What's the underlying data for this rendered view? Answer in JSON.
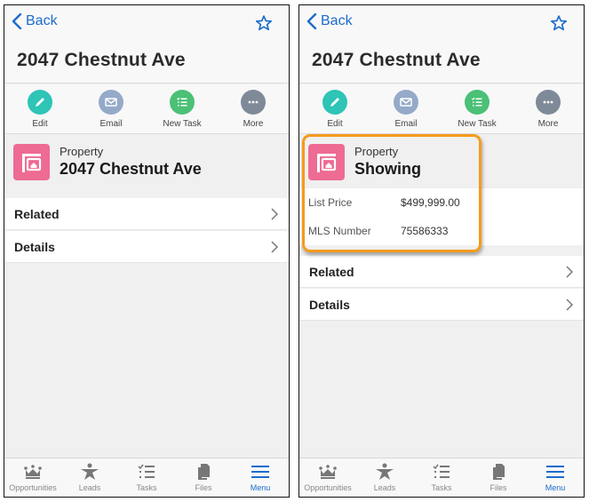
{
  "colors": {
    "accent": "#1c6ccb",
    "edit": "#2ec4b6",
    "email": "#95aac9",
    "new_task": "#4bc076",
    "more": "#7f8a99",
    "object_icon": "#ee6b93",
    "highlight": "#f59b1b"
  },
  "screens": [
    {
      "nav": {
        "back_label": "Back",
        "back_icon": "chevron-left-icon",
        "favorite_icon": "star-outline-icon"
      },
      "title": "2047 Chestnut Ave",
      "actions": [
        {
          "label": "Edit",
          "icon": "pencil-icon"
        },
        {
          "label": "Email",
          "icon": "envelope-icon"
        },
        {
          "label": "New Task",
          "icon": "task-list-icon"
        },
        {
          "label": "More",
          "icon": "ellipsis-icon"
        }
      ],
      "header": {
        "object_type": "Property",
        "record_name": "2047 Chestnut Ave",
        "icon": "property-icon"
      },
      "rows": [
        {
          "label": "Related"
        },
        {
          "label": "Details"
        }
      ],
      "tabbar": [
        {
          "label": "Opportunities",
          "icon": "crown-icon",
          "active": false
        },
        {
          "label": "Leads",
          "icon": "person-star-icon",
          "active": false
        },
        {
          "label": "Tasks",
          "icon": "task-list-icon",
          "active": false
        },
        {
          "label": "Files",
          "icon": "files-icon",
          "active": false
        },
        {
          "label": "Menu",
          "icon": "hamburger-icon",
          "active": true
        }
      ]
    },
    {
      "nav": {
        "back_label": "Back",
        "back_icon": "chevron-left-icon",
        "favorite_icon": "star-outline-icon"
      },
      "title": "2047 Chestnut Ave",
      "actions": [
        {
          "label": "Edit",
          "icon": "pencil-icon"
        },
        {
          "label": "Email",
          "icon": "envelope-icon"
        },
        {
          "label": "New Task",
          "icon": "task-list-icon"
        },
        {
          "label": "More",
          "icon": "ellipsis-icon"
        }
      ],
      "header": {
        "object_type": "Property",
        "record_name": "Showing",
        "icon": "property-icon"
      },
      "fields": [
        {
          "label": "List Price",
          "value": "$499,999.00"
        },
        {
          "label": "MLS Number",
          "value": "75586333"
        }
      ],
      "rows": [
        {
          "label": "Related"
        },
        {
          "label": "Details"
        }
      ],
      "tabbar": [
        {
          "label": "Opportunities",
          "icon": "crown-icon",
          "active": false
        },
        {
          "label": "Leads",
          "icon": "person-star-icon",
          "active": false
        },
        {
          "label": "Tasks",
          "icon": "task-list-icon",
          "active": false
        },
        {
          "label": "Files",
          "icon": "files-icon",
          "active": false
        },
        {
          "label": "Menu",
          "icon": "hamburger-icon",
          "active": true
        }
      ]
    }
  ]
}
